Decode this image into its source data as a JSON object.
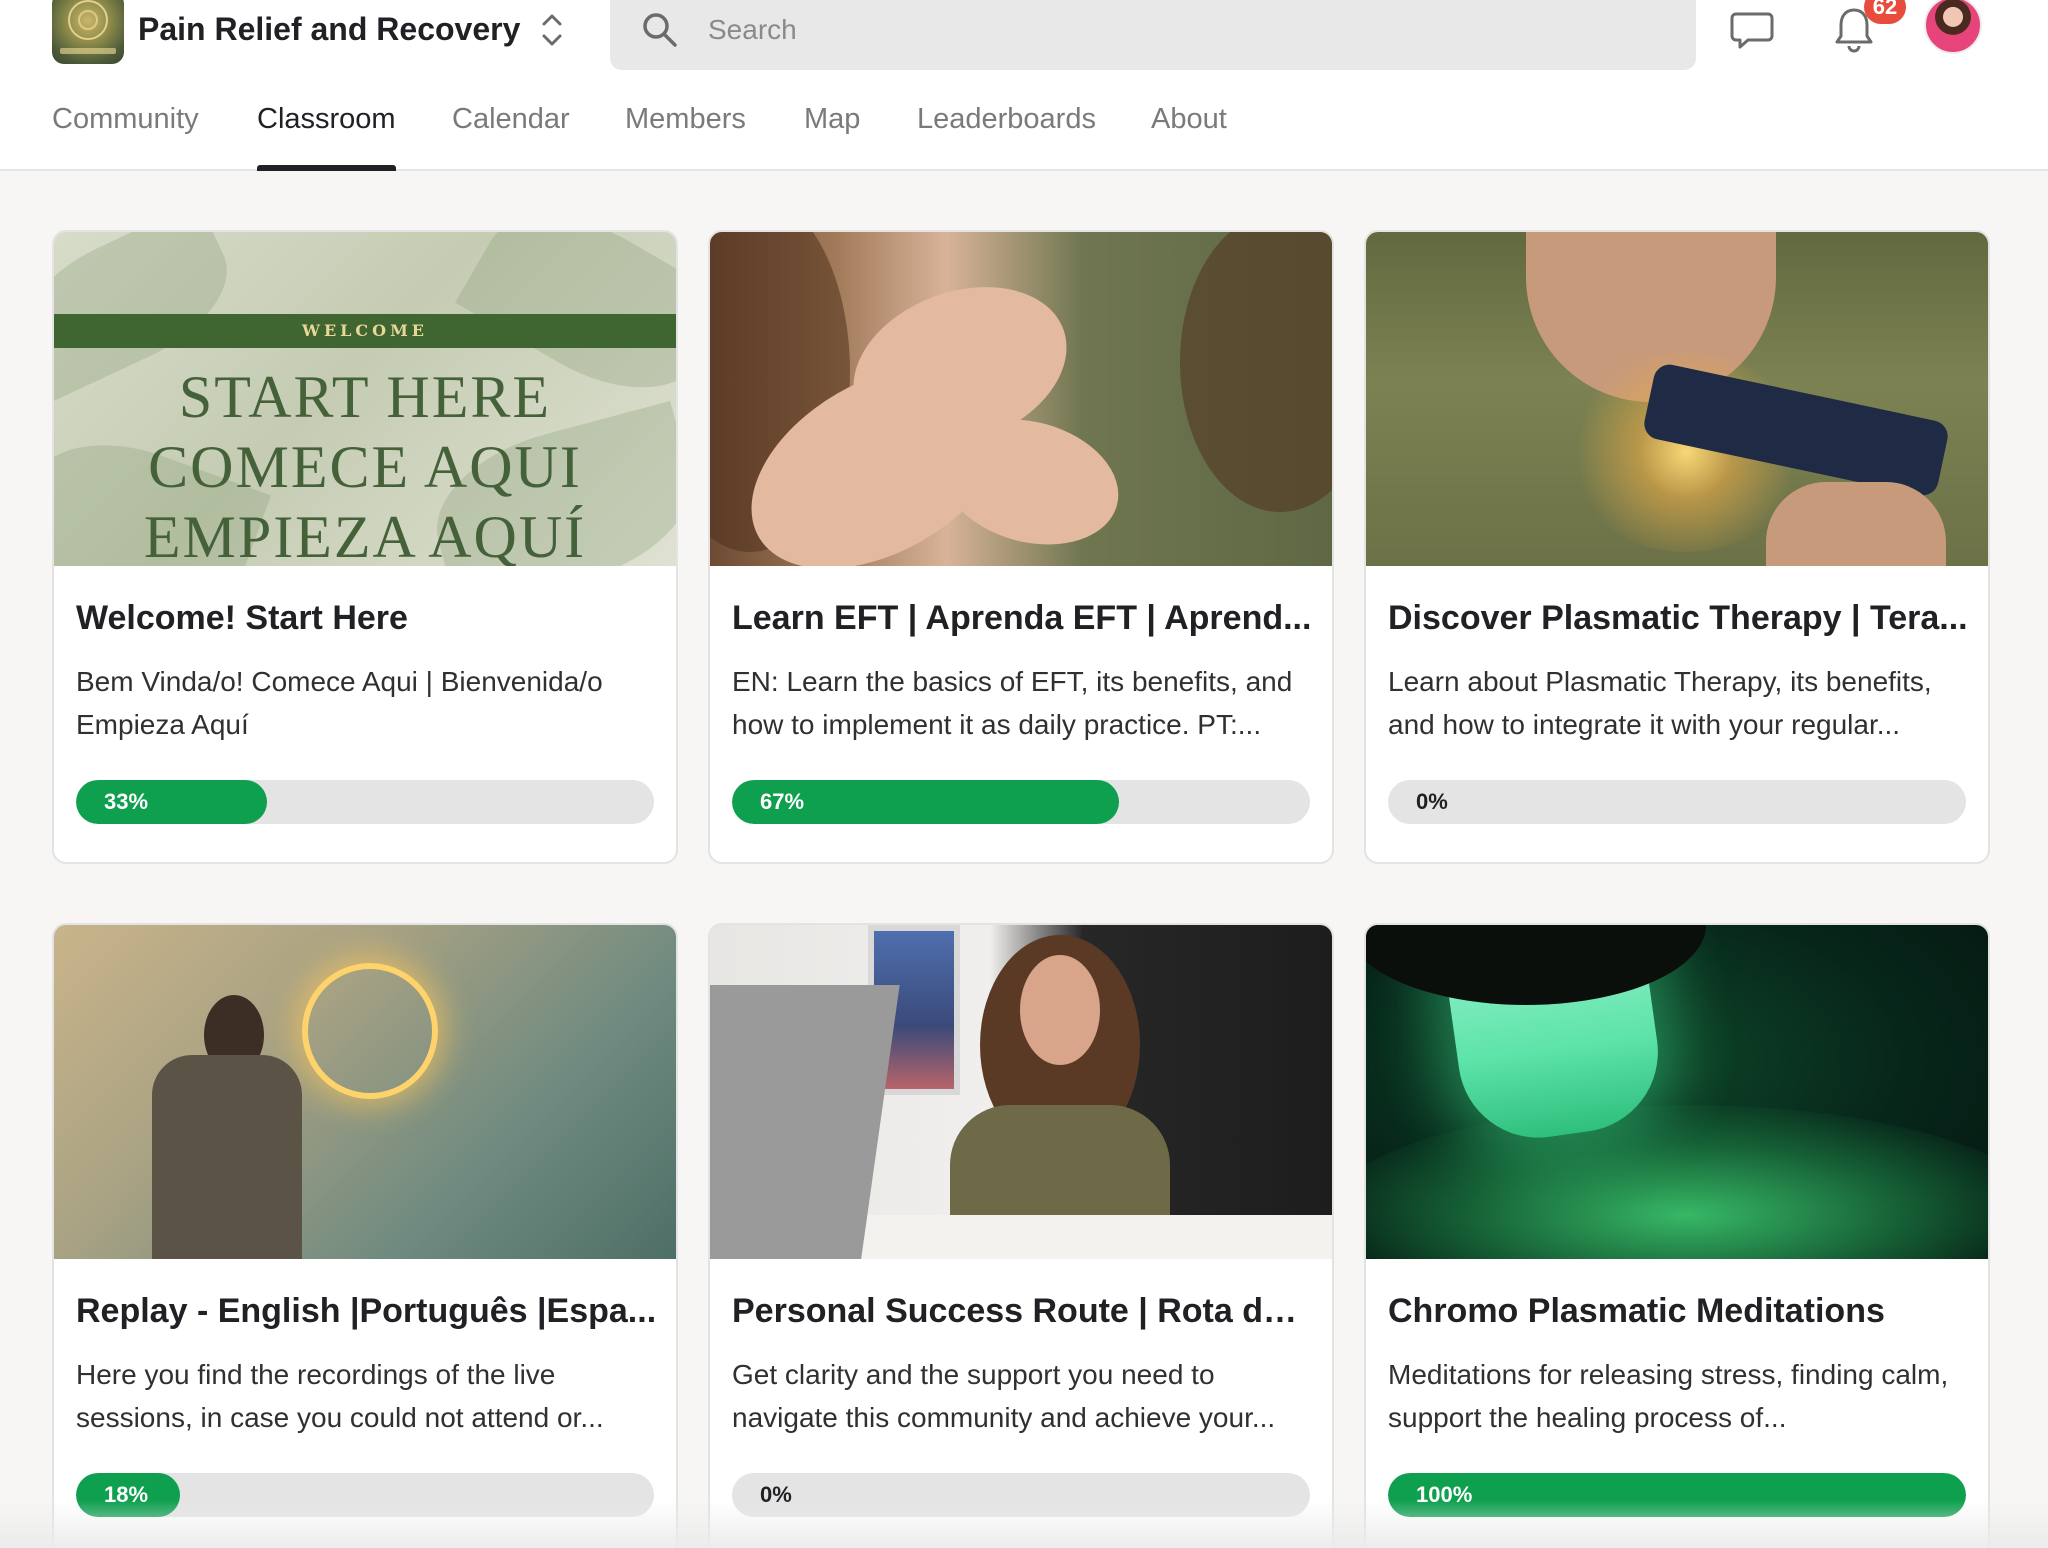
{
  "header": {
    "group_name": "Pain Relief and Recovery",
    "search_placeholder": "Search",
    "notifications_count": "62"
  },
  "tabs": [
    {
      "label": "Community",
      "active": false
    },
    {
      "label": "Classroom",
      "active": true
    },
    {
      "label": "Calendar",
      "active": false
    },
    {
      "label": "Members",
      "active": false
    },
    {
      "label": "Map",
      "active": false
    },
    {
      "label": "Leaderboards",
      "active": false
    },
    {
      "label": "About",
      "active": false
    }
  ],
  "courses": [
    {
      "title": "Welcome! Start Here",
      "description": "Bem Vinda/o! Comece Aqui | Bienvenida/o Empieza Aquí",
      "progress_label": "33%",
      "progress": 0.33,
      "cover_band": "WELCOME",
      "cover_lines": [
        "START HERE",
        "COMECE AQUI",
        "EMPIEZA AQUÍ"
      ]
    },
    {
      "title": "Learn EFT | Aprenda EFT | Aprend...",
      "description": "EN: Learn the basics of EFT, its benefits, and how to implement it as daily practice. PT:...",
      "progress_label": "67%",
      "progress": 0.67
    },
    {
      "title": "Discover Plasmatic Therapy | Tera...",
      "description": "Learn about Plasmatic Therapy, its benefits, and how to integrate it with your regular...",
      "progress_label": "0%",
      "progress": 0
    },
    {
      "title": "Replay - English |Português |Espa...",
      "description": "Here you find the recordings of the live sessions, in case you could not attend or...",
      "progress_label": "18%",
      "progress": 0.18
    },
    {
      "title": "Personal Success Route | Rota de ...",
      "description": "Get clarity and the support you need to navigate this community and achieve your...",
      "progress_label": "0%",
      "progress": 0
    },
    {
      "title": "Chromo Plasmatic Meditations",
      "description": "Meditations for releasing stress, finding calm, support the healing process of...",
      "progress_label": "100%",
      "progress": 1
    }
  ],
  "colors": {
    "progress_fill": "#0e9f4f",
    "progress_track": "#e4e4e4",
    "badge": "#e74c3c"
  },
  "icons": [
    "group-logo",
    "switcher-chevrons-icon",
    "search-icon",
    "chat-icon",
    "bell-icon",
    "avatar"
  ]
}
